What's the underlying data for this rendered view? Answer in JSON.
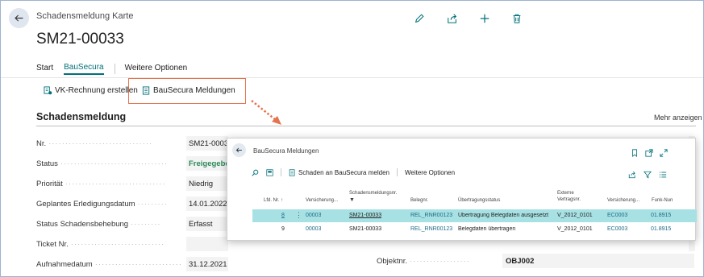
{
  "page": {
    "kind": "Schadensmeldung Karte",
    "title": "SM21-00033"
  },
  "tabs": [
    {
      "label": "Start"
    },
    {
      "label": "BauSecura"
    },
    {
      "label": "Weitere Optionen"
    }
  ],
  "actions": {
    "vk_rechnung": "VK-Rechnung erstellen",
    "bausecura_meldungen": "BauSecura Meldungen"
  },
  "section": {
    "title": "Schadensmeldung",
    "more": "Mehr anzeigen"
  },
  "fields": [
    {
      "label": "Nr.",
      "value": "SM21-00033"
    },
    {
      "label": "Status",
      "value": "Freigegeben"
    },
    {
      "label": "Priorität",
      "value": "Niedrig"
    },
    {
      "label": "Geplantes Erledigungsdatum",
      "value": "14.01.2022"
    },
    {
      "label": "Status Schadensbehebung",
      "value": "Erfasst"
    },
    {
      "label": "Ticket Nr.",
      "value": ""
    },
    {
      "label": "Aufnahmedatum",
      "value": "31.12.2021"
    }
  ],
  "right_field": {
    "label": "Objektnr.",
    "value": "OBJ002"
  },
  "colors": {
    "accent": "#00707a",
    "highlight": "#e5734d",
    "selected_row": "#a8e1e3",
    "link": "#1d6b87"
  },
  "popup": {
    "title": "BauSecura Meldungen",
    "toolbar": {
      "report_label": "Schaden an BauSecura melden",
      "more_label": "Weitere Optionen"
    },
    "columns": [
      "Lfd. Nr. ↑",
      "Versicherung...",
      "Schadensmeldungsnr.",
      "Belegnr.",
      "Übertragungsstatus",
      "Externe Vertragsnr.",
      "Versicherung...",
      "Funk-Nun"
    ],
    "rows": [
      {
        "lfd": "8",
        "versicherung": "00003",
        "schadensmeldung": "SM21-00033",
        "beleg": "REL_RNR00123",
        "status": "Übertragung Belegdaten ausgesetzt",
        "vertrag": "V_2012_0101",
        "versicherung2": "EC0003",
        "funk": "01.8915"
      },
      {
        "lfd": "9",
        "versicherung": "00003",
        "schadensmeldung": "SM21-00033",
        "beleg": "REL_RNR00123",
        "status": "Belegdaten übertragen",
        "vertrag": "V_2012_0101",
        "versicherung2": "EC0003",
        "funk": "01.8915"
      }
    ]
  }
}
